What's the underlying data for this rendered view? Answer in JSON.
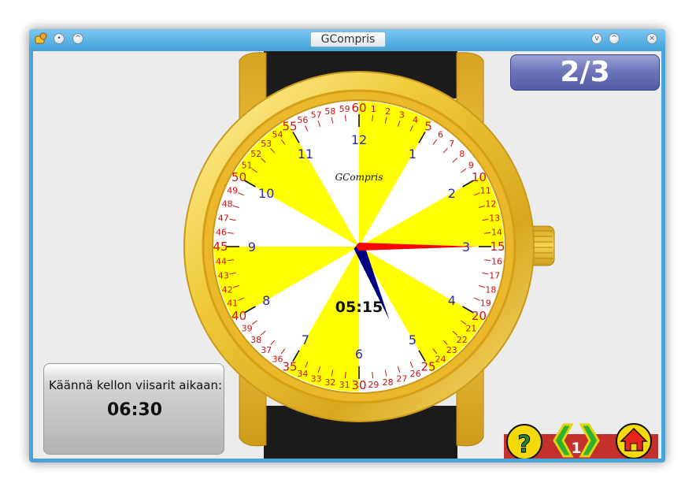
{
  "window": {
    "title": "GCompris"
  },
  "score": {
    "text": "2/3"
  },
  "instruction": {
    "text": "Käännä kellon viisarit aikaan:",
    "target_time": "06:30"
  },
  "clock": {
    "brand": "GCompris",
    "current_time": "05:15",
    "hours": [
      "12",
      "1",
      "2",
      "3",
      "4",
      "5",
      "6",
      "7",
      "8",
      "9",
      "10",
      "11"
    ],
    "minutes": [
      "60",
      "1",
      "2",
      "3",
      "4",
      "5",
      "6",
      "7",
      "8",
      "9",
      "10",
      "11",
      "12",
      "13",
      "14",
      "15",
      "16",
      "17",
      "18",
      "19",
      "20",
      "21",
      "22",
      "23",
      "24",
      "25",
      "26",
      "27",
      "28",
      "29",
      "30",
      "31",
      "32",
      "33",
      "34",
      "35",
      "36",
      "37",
      "38",
      "39",
      "40",
      "41",
      "42",
      "43",
      "44",
      "45",
      "46",
      "47",
      "48",
      "49",
      "50",
      "51",
      "52",
      "53",
      "54",
      "55",
      "56",
      "57",
      "58",
      "59"
    ],
    "hour_hand_value": 5.25,
    "minute_hand_value": 15,
    "colors": {
      "sector": "#ffff00",
      "hour_numbers": "#2b2bb8",
      "minute_numbers": "#cc1111",
      "hour_hand": "#000080",
      "minute_hand": "#ff0000",
      "case": "#e9c02e"
    }
  },
  "controls": {
    "level": "1",
    "help_icon": "question-mark",
    "prev_icon": "chevron-left",
    "next_icon": "chevron-right",
    "home_icon": "house"
  }
}
